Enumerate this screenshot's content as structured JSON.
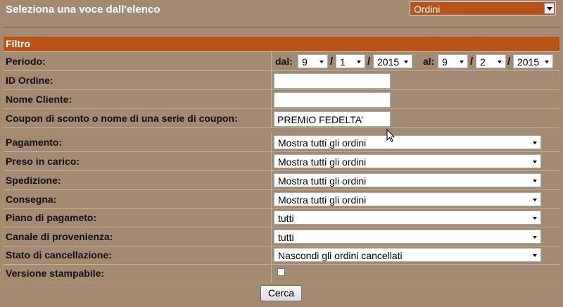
{
  "header": {
    "title": "Seleziona una voce dall'elenco",
    "section_select": "Ordini"
  },
  "panel": {
    "title": "Filtro"
  },
  "filters": {
    "period": {
      "label": "Periodo:",
      "from_label": "dal:",
      "to_label": "al:",
      "separator": "/",
      "from": {
        "day": "9",
        "month": "1",
        "year": "2015"
      },
      "to": {
        "day": "9",
        "month": "2",
        "year": "2015"
      }
    },
    "order_id": {
      "label": "ID Ordine:",
      "value": ""
    },
    "customer_name": {
      "label": "Nome Cliente:",
      "value": ""
    },
    "coupon": {
      "label": "Coupon di sconto o nome di una serie di coupon:",
      "value": "PREMIO FEDELTA’"
    },
    "payment": {
      "label": "Pagamento:",
      "value": "Mostra tutti gli ordini"
    },
    "taken_charge": {
      "label": "Preso in carico:",
      "value": "Mostra tutti gli ordini"
    },
    "shipping": {
      "label": "Spedizione:",
      "value": "Mostra tutti gli ordini"
    },
    "delivery": {
      "label": "Consegna:",
      "value": "Mostra tutti gli ordini"
    },
    "payment_plan": {
      "label": "Piano di pagameto:",
      "value": "tutti"
    },
    "source_channel": {
      "label": "Canale di provenienza:",
      "value": "tutti"
    },
    "cancellation_status": {
      "label": "Stato di cancellazione:",
      "value": "Nascondi gli ordini cancellati"
    },
    "printable": {
      "label": "Versione stampabile:",
      "checked": false
    }
  },
  "actions": {
    "search_label": "Cerca"
  },
  "colors": {
    "background": "#a38a73",
    "accent": "#b8541a"
  }
}
